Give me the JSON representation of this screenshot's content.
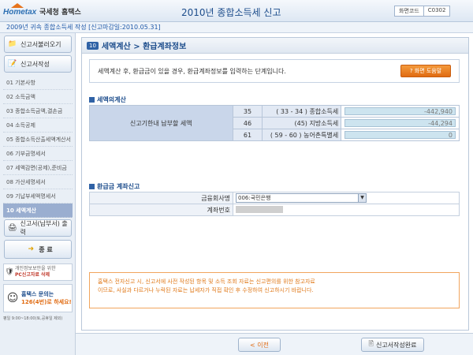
{
  "header": {
    "logo_brand": "Hometax",
    "logo_text": "국세청 홈택스",
    "title": "2010년 종합소득세 신고",
    "screen_code_label": "화면코드",
    "screen_code": "C0302"
  },
  "subheader": "2009년 귀속 종합소득세 작성 [신고마감일:2010.05.31]",
  "sidebar": {
    "load_button": "신고서불러오기",
    "write_button": "신고서작성",
    "items": [
      {
        "label": "01 기본사항"
      },
      {
        "label": "02 소득금액"
      },
      {
        "label": "03 종합소득금액,결손금"
      },
      {
        "label": "04 소득공제"
      },
      {
        "label": "05 종합소득산출세액계산서"
      },
      {
        "label": "06 기부금명세서"
      },
      {
        "label": "07 세액감면(공제),준비금"
      },
      {
        "label": "08 가산세명세서"
      },
      {
        "label": "09 기납부세액명세서"
      },
      {
        "label": "10 세액계산"
      }
    ],
    "print_button": "신고서(납부서) 출력",
    "exit_button": "종 료",
    "pc_notice_line1": "개인정보보안을 위한",
    "pc_notice_line2": "PC신고자료 삭제",
    "call_line1": "홈택스 문의는",
    "call_line2": "126(4번)로 하세요!",
    "call_line3": "평일 9:00~18:00(토,공휴일 제외)"
  },
  "main": {
    "badge": "10",
    "title": "세액계산 > 환급계좌정보",
    "info_text": "세액계산 후, 환급금이 있을 경우, 환급계좌정보를 입력하는 단계입니다.",
    "help_button": "? 화면 도움말",
    "section1_title": "세액의계산",
    "calc_label": "신고기한내 납부할 세액",
    "calc_rows": [
      {
        "num": "35",
        "name": "( 33 - 34 ) 종합소득세",
        "value": "-442,940"
      },
      {
        "num": "46",
        "name": "(45) 지방소득세",
        "value": "-44,294"
      },
      {
        "num": "61",
        "name": "( 59 - 60 ) 농어촌특별세",
        "value": "0"
      }
    ],
    "section2_title": "환급금 계좌신고",
    "bank_label": "금융회사명",
    "bank_value": "006:국민은행",
    "account_label": "계좌번호",
    "notice_line1": "홈택스 전자신고 시, 신고서에 사전 작성된 항목 및 소득 조회 자료는 신고편의를 위한 참고자료",
    "notice_line2": "이므로, 사실과 다르거나 누락된 자료는 납세자가 직접 확인 후 수정하여 신고하시기 바랍니다."
  },
  "footer": {
    "prev_button": "< 이전",
    "complete_button": "신고서작성완료"
  },
  "colors": {
    "accent": "#2f62a6",
    "help_orange": "#e06b12",
    "notice_text": "#e07a1b",
    "active_menu": "#9aaed0"
  }
}
